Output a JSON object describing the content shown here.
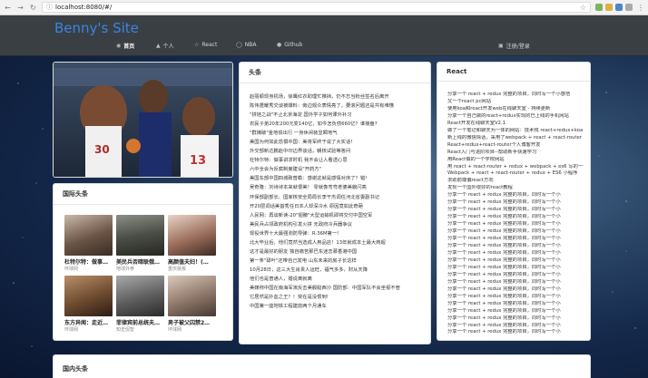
{
  "browser": {
    "url": "localhost:8080/#/"
  },
  "site": {
    "brand": "Benny's Site",
    "nav": [
      {
        "label": "首页",
        "icon": "home-icon"
      },
      {
        "label": "个人",
        "icon": "thumbs-up-icon"
      },
      {
        "label": "React",
        "icon": "star-icon"
      },
      {
        "label": "NBA",
        "icon": "basketball-icon"
      },
      {
        "label": "Github",
        "icon": "github-icon"
      }
    ],
    "login": "注册/登录"
  },
  "intl": {
    "title": "国际头条",
    "cards": [
      {
        "title": "杜特尔特：做事…",
        "source": "环球网"
      },
      {
        "title": "美民兵否暗联俄…",
        "source": "地球外参"
      },
      {
        "title": "高颜值夫妇！(…",
        "source": "重庆晨报"
      },
      {
        "title": "东方异闻：走近…",
        "source": "环球网"
      },
      {
        "title": "菲律宾前总统夫…",
        "source": "知史侃智"
      },
      {
        "title": "男子被父囚禁2…",
        "source": "环球网"
      }
    ]
  },
  "headlines": {
    "title": "头条",
    "items": [
      "赵丽颖现身机场，徐鹰红衣助理忙推挡，仍不忘当粉丝签名后离开",
      "陈伟霆耀秀交谈被爆料：旁边观众表情亮了，要滚问题还是共有难懂",
      "\"拼娃之战\"不止北京海淀 国外学子如何课外补习",
      "农民子弟20年200元变140亿，如今怎负债660亿？谁接盘?",
      "\"群媒破\"金地铁出行 一身休闲装显瞬地气",
      "美国为何如此恐惧中国：美将军终于说了大实话!",
      "外交部新达鹏赵中印边界谈话，朝核试验等答问",
      "杜特尔特：做事讲求时机 我不会让人看透心思",
      "六中全会为反腐制度建设\"开药方\"",
      "美国东部中国四城致普勒：感谢这就是感情对床了？错!",
      "吴奇隆：刘诗诗本来就很美！  零就像弯弯老婆美貌闪亮",
      "环保部副部长、国家核安全局局长李干杰调任河北省委副书记",
      "开20层调话美首秀任日本人却深冷水 原因竟如此奇葩",
      "人民网：再谈新读-20\"翅膀\"大型运输机即将交付中国空军",
      "美民兵占领政府机构引发火拼 无政府冷兵器争议",
      "现役世界十大最强测防导弹：R-36M第一!",
      "北大毕业后，他们竟然当选成人用品店！13年就成本土最大商超",
      "这才是最好的朋友 独自痛苦那巴东迷恋慕香港中国",
      "第一条\"碌叶\"还带自己发电 山东未来的房子长这样",
      "10月28日，这三大生肖贵人运旺，福气多多，财从天降",
      "他们也是普通人，婚说离就离",
      "美媒称中国在南海军演反击美舰艇西沙 国防部：中国军队不会坐视不管",
      "它居然是扑血之王？！突在是没惯到!",
      "中国第一座地铁工程建前两个月通车"
    ]
  },
  "react": {
    "title": "React",
    "items": [
      "分享一个 react + redux 完整的项目，同时写一个小感悟",
      "又一个react pc网站",
      "使用koa和react开发web在线聊天室 - 持续更新",
      "分享一个自己做的react+redux实现的已上线的手机网站",
      "React开发在线聊天室V2.1",
      "做了一个笔记和聊天为一体的网站：技术栈 react+redux+koa",
      "新上线的微信情话，采用了webpack + react + react-router",
      "React+redux+react-router个人博客开发",
      "React入门与进阶项目--帮助新手快速学习",
      "用React做的一个学校网站",
      "用 react + react-router + redux + webpack + es6 写的一个",
      "Webpack + react + react-router + redux + ES6 小程序",
      "求助前端偏react方向",
      "发现一个国外很好的react教程",
      "分享一个 react + redux 完整的项目，同时写一个小",
      "分享一个 react + redux 完整的项目，同时写一个小",
      "分享一个 react + redux 完整的项目，同时写一个小",
      "分享一个 react + redux 完整的项目，同时写一个小",
      "分享一个 react + redux 完整的项目，同时写一个小",
      "分享一个 react + redux 完整的项目，同时写一个小",
      "分享一个 react + redux 完整的项目，同时写一个小",
      "分享一个 react + redux 完整的项目，同时写一个小",
      "分享一个 react + redux 完整的项目，同时写一个小",
      "分享一个 react + redux 完整的项目，同时写一个小",
      "分享一个 react + redux 完整的项目，同时写一个小",
      "分享一个 react + redux 完整的项目，同时写一个小",
      "分享一个 react + redux 完整的项目，同时写一个小",
      "分享一个 react + redux 完整的项目，同时写一个小",
      "分享一个 react + redux 完整的项目，同时写一个小",
      "分享一个 react + redux 完整的项目，同时写一个小",
      "分享一个 react + redux 完整的项目，同时写一个小",
      "分享一个 react + redux 完整的项目，同时写一个小",
      "分享一个 react + redux 完整的项目，同时写一个小",
      "分享一个 react + redux 完整的项目，同时写一个小"
    ]
  },
  "domestic": {
    "title": "国内头条"
  }
}
